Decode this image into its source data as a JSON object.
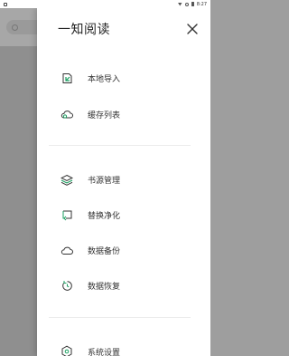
{
  "drawer": {
    "title": "一知阅读"
  },
  "menu": {
    "group1": [
      {
        "label": "本地导入",
        "icon": "import-file-icon"
      },
      {
        "label": "缓存列表",
        "icon": "cloud-cache-icon"
      }
    ],
    "group2": [
      {
        "label": "书源管理",
        "icon": "layers-icon"
      },
      {
        "label": "替换净化",
        "icon": "replace-icon"
      },
      {
        "label": "数据备份",
        "icon": "cloud-backup-icon"
      },
      {
        "label": "数据恢复",
        "icon": "restore-icon"
      }
    ],
    "group3": [
      {
        "label": "系统设置",
        "icon": "settings-icon"
      }
    ]
  },
  "status_bar": {
    "time": "8:27"
  },
  "colors": {
    "icon_accent": "#1a9f60",
    "icon_dark": "#333333"
  }
}
